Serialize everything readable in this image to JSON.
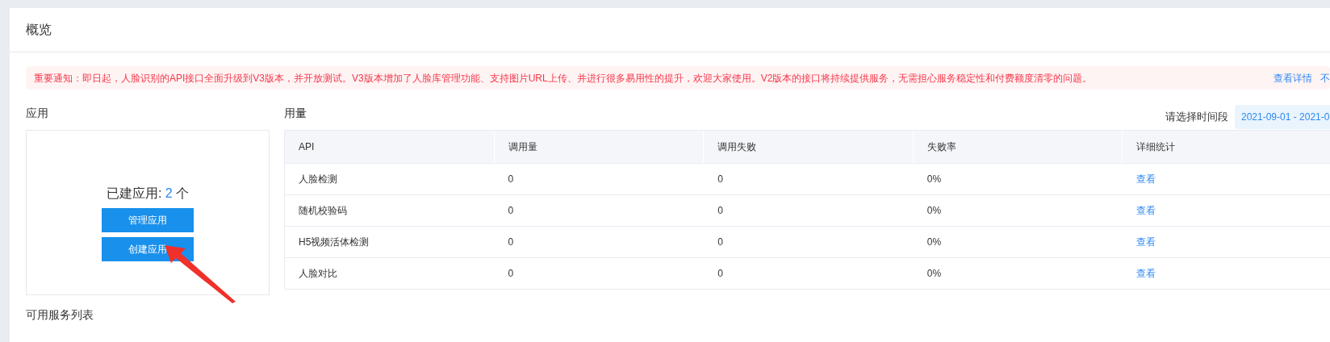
{
  "page": {
    "title": "概览"
  },
  "notice": {
    "text": "重要通知：即日起，人脸识别的API接口全面升级到V3版本，并开放测试。V3版本增加了人脸库管理功能、支持图片URL上传、并进行很多易用性的提升，欢迎大家使用。V2版本的接口将持续提供服务，无需担心服务稳定性和付费额度清零的问题。",
    "links": [
      "查看详情",
      "不"
    ]
  },
  "apps": {
    "title": "应用",
    "count_label": "已建应用: ",
    "count": "2",
    "unit": " 个",
    "buttons": [
      "管理应用",
      "创建应用"
    ]
  },
  "usage": {
    "title": "用量",
    "date_label": "请选择时间段",
    "date_value": "2021-09-01 - 2021-0",
    "columns": [
      "API",
      "调用量",
      "调用失败",
      "失败率",
      "详细统计"
    ],
    "rows": [
      [
        "人脸检测",
        "0",
        "0",
        "0%",
        "查看"
      ],
      [
        "随机校验码",
        "0",
        "0",
        "0%",
        "查看"
      ],
      [
        "H5视频活体检测",
        "0",
        "0",
        "0%",
        "查看"
      ],
      [
        "人脸对比",
        "0",
        "0",
        "0%",
        "查看"
      ]
    ]
  },
  "services": {
    "title": "可用服务列表"
  }
}
